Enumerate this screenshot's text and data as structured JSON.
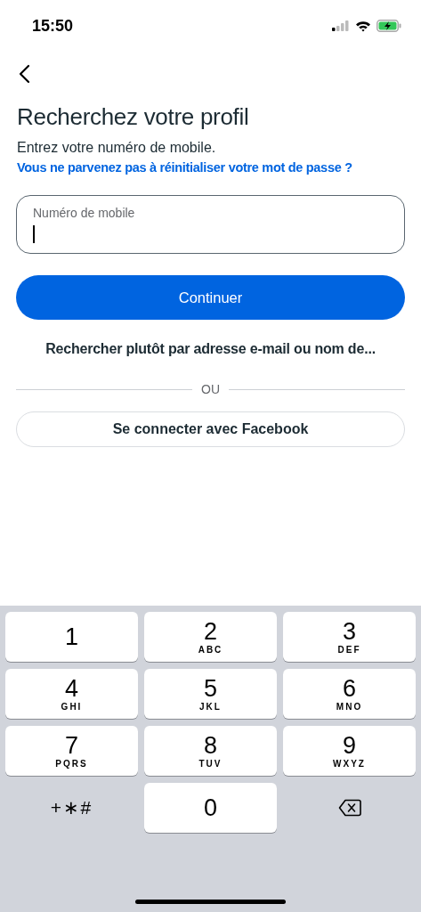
{
  "status_bar": {
    "time": "15:50"
  },
  "title": "Recherchez votre profil",
  "subtitle": "Entrez votre numéro de mobile.",
  "help_link": "Vous ne parvenez pas à réinitialiser votre mot de passe ?",
  "phone_field": {
    "label": "Numéro de mobile",
    "focused": true
  },
  "continue_button": "Continuer",
  "alt_search_link": "Rechercher plutôt par adresse e-mail ou nom de...",
  "divider": "OU",
  "facebook_button": "Se connecter avec Facebook",
  "keypad": [
    {
      "kind": "key",
      "digit": "1"
    },
    {
      "kind": "key",
      "digit": "2",
      "letters": "ABC"
    },
    {
      "kind": "key",
      "digit": "3",
      "letters": "DEF"
    },
    {
      "kind": "key",
      "digit": "4",
      "letters": "GHI"
    },
    {
      "kind": "key",
      "digit": "5",
      "letters": "JKL"
    },
    {
      "kind": "key",
      "digit": "6",
      "letters": "MNO"
    },
    {
      "kind": "key",
      "digit": "7",
      "letters": "PQRS"
    },
    {
      "kind": "key",
      "digit": "8",
      "letters": "TUV"
    },
    {
      "kind": "key",
      "digit": "9",
      "letters": "WXYZ"
    },
    {
      "kind": "symbols",
      "digit": "+∗#"
    },
    {
      "kind": "key",
      "digit": "0"
    },
    {
      "kind": "delete"
    }
  ]
}
